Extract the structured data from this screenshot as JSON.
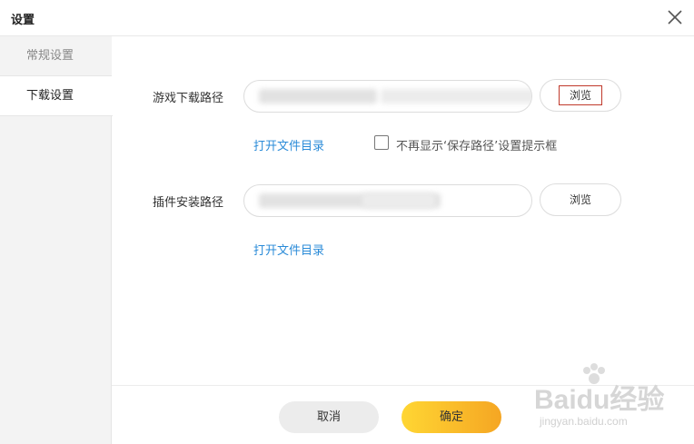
{
  "window": {
    "title": "设置"
  },
  "sidebar": {
    "items": [
      {
        "label": "常规设置",
        "active": false
      },
      {
        "label": "下载设置",
        "active": true
      }
    ]
  },
  "game_download": {
    "label": "游戏下载路径",
    "browse_label": "浏览",
    "open_folder_label": "打开文件目录",
    "no_prompt_checkbox_label": "不再显示‘保存路径’设置提示框",
    "no_prompt_checked": false
  },
  "plugin_install": {
    "label": "插件安装路径",
    "browse_label": "浏览",
    "open_folder_label": "打开文件目录"
  },
  "footer": {
    "cancel_label": "取消",
    "ok_label": "确定"
  },
  "watermark": {
    "text": "Baidu经验",
    "url": "jingyan.baidu.com"
  },
  "colors": {
    "link": "#2a8bd8",
    "ok_button_start": "#ffd633",
    "ok_button_end": "#f5a623",
    "highlight": "#c0392b"
  }
}
